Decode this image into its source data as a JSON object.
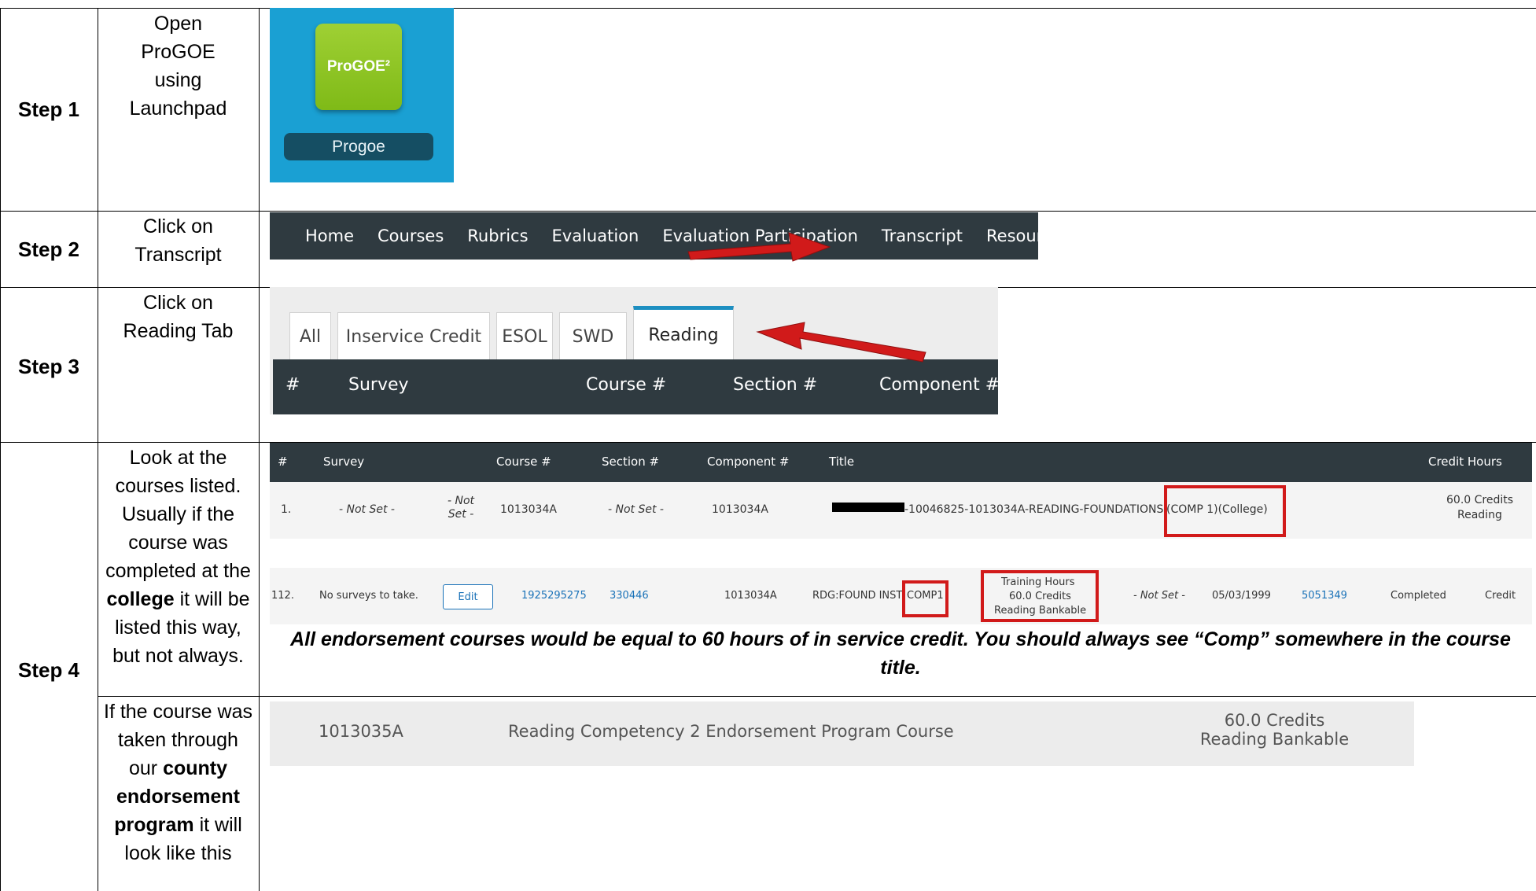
{
  "steps": [
    {
      "label": "Step 1",
      "instruction": "Open ProGOE using Launchpad"
    },
    {
      "label": "Step 2",
      "instruction": "Click on Transcript"
    },
    {
      "label": "Step 3",
      "instruction": "Click on Reading Tab"
    },
    {
      "label": "Step 4",
      "instruction_part1": "Look at the courses listed. Usually if the course was completed at the",
      "instruction_bold1": "college",
      "instruction_part2": "it will be listed this way, but not always.",
      "instruction2_part1": "If the course was taken through our",
      "instruction2_bold": "county endorsement program",
      "instruction2_part2": "it will look like this"
    }
  ],
  "launchpad": {
    "icon_text": "ProGOE²",
    "app_name": "Progoe",
    "icon": "progoe-app-icon"
  },
  "navbar": {
    "items": [
      "Home",
      "Courses",
      "Rubrics",
      "Evaluation",
      "Evaluation Participation",
      "Transcript",
      "Resources"
    ]
  },
  "tabs": {
    "items": [
      "All",
      "Inservice Credit",
      "ESOL",
      "SWD",
      "Reading"
    ],
    "active": "Reading",
    "header": [
      "#",
      "Survey",
      "Course #",
      "Section #",
      "Component #"
    ]
  },
  "transcript": {
    "header": [
      "#",
      "Survey",
      "Course #",
      "Section #",
      "Component #",
      "Title",
      "Credit Hours"
    ],
    "row1": {
      "num": "1.",
      "survey": "- Not Set -",
      "survey2": "- Not Set -",
      "course": "1013034A",
      "section": "- Not Set -",
      "component": "1013034A",
      "title": "-10046825-1013034A-READING-FOUNDATIONS",
      "title_highlight": "(COMP 1)(College)",
      "credit_line1": "60.0 Credits",
      "credit_line2": "Reading"
    },
    "row2": {
      "num": "112.",
      "survey": "No surveys to take.",
      "edit": "Edit",
      "link1": "1925295275",
      "link2": "330446",
      "component": "1013034A",
      "title": "RDG:FOUND INST",
      "title_highlight": "COMP1",
      "credit_line1": "Training Hours",
      "credit_line2": "60.0 Credits",
      "credit_line3": "Reading Bankable",
      "not_set": "- Not Set -",
      "date": "05/03/1999",
      "link3": "5051349",
      "status": "Completed",
      "type": "Credit"
    }
  },
  "note": "All endorsement courses would be equal to 60 hours of in service credit.  You should always see “Comp” somewhere in the course title.",
  "county": {
    "course": "1013035A",
    "title": "Reading Competency 2 Endorsement Program Course",
    "credit_line1": "60.0 Credits",
    "credit_line2": "Reading Bankable"
  },
  "colors": {
    "arrow": "#d11a1a",
    "tile_bg": "#1aa0d3",
    "icon_green": "#8cc326",
    "dark_header": "#2f3a40"
  }
}
